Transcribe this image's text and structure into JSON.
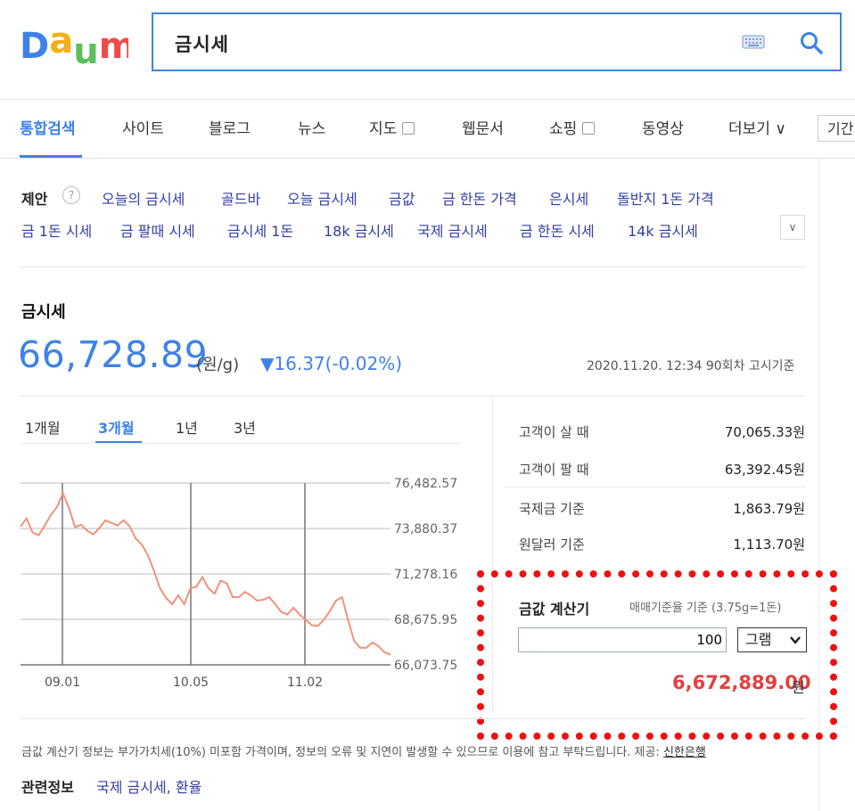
{
  "header": {
    "logo_text": "Daum",
    "search_value": "금시세"
  },
  "tabs": [
    {
      "label": "통합검색",
      "active": true
    },
    {
      "label": "사이트"
    },
    {
      "label": "블로그"
    },
    {
      "label": "뉴스"
    },
    {
      "label": "지도",
      "box": true
    },
    {
      "label": "웹문서"
    },
    {
      "label": "쇼핑",
      "box": true
    },
    {
      "label": "동영상"
    },
    {
      "label": "더보기 ∨"
    }
  ],
  "period_filter": "기간",
  "suggestions": {
    "label": "제안",
    "help": "?",
    "row1": [
      "오늘의 금시세",
      "골드바",
      "오늘 금시세",
      "금값",
      "금 한돈 가격",
      "은시세",
      "돌반지 1돈 가격"
    ],
    "row2": [
      "금 1돈 시세",
      "금 팔때 시세",
      "금시세 1돈",
      "18k 금시세",
      "국제 금시세",
      "금 한돈 시세",
      "14k 금시세"
    ],
    "more": "∨"
  },
  "gold": {
    "title": "금시세",
    "price": "66,728.89",
    "unit": "(원/g)",
    "change": "▼16.37(-0.02%)",
    "notice": "2020.11.20. 12:34 90회차 고시기준"
  },
  "period_tabs": [
    {
      "label": "1개월"
    },
    {
      "label": "3개월",
      "active": true
    },
    {
      "label": "1년"
    },
    {
      "label": "3년"
    }
  ],
  "chart_data": {
    "type": "line",
    "title": "",
    "xlabel": "",
    "ylabel": "",
    "x_ticks": [
      "09.01",
      "10.05",
      "11.02"
    ],
    "y_ticks": [
      "76,482.57",
      "73,880.37",
      "71,278.16",
      "68,675.95",
      "66,073.75"
    ],
    "ylim": [
      66073.75,
      76482.57
    ],
    "grid": true,
    "color": "#f0927a",
    "series": [
      {
        "values": [
          74000,
          74450,
          73650,
          73500,
          74050,
          74650,
          75100,
          75900,
          75050,
          73950,
          74100,
          73750,
          73550,
          73900,
          74350,
          74200,
          74050,
          74350,
          74000,
          73300,
          72950,
          72350,
          71450,
          70450,
          69900,
          69550,
          70050,
          69550,
          70450,
          70550,
          71100,
          70450,
          70150,
          70900,
          70750,
          69950,
          69950,
          70250,
          70050,
          69750,
          69800,
          69950,
          69550,
          69100,
          68950,
          69350,
          68950,
          68650,
          68350,
          68300,
          68650,
          69150,
          69750,
          69950,
          68650,
          67450,
          67050,
          67050,
          67350,
          67150,
          66800,
          66650
        ]
      }
    ]
  },
  "side_table": [
    {
      "label": "고객이 살 때",
      "value": "70,065.33원"
    },
    {
      "label": "고객이 팔 때",
      "value": "63,392.45원"
    },
    {
      "label": "국제금 기준",
      "value": "1,863.79원"
    },
    {
      "label": "원달러 기준",
      "value": "1,113.70원"
    }
  ],
  "calculator": {
    "title": "금값 계산기",
    "basis": "매매기준율 기준 (3.75g=1돈)",
    "input_value": "100",
    "unit_select": "그램",
    "result": "6,672,889.00",
    "result_unit": "원"
  },
  "disclaimer_text": "금값 계산기 정보는 부가가치세(10%) 미포함 가격이며, 정보의 오류 및 지연이 발생할 수 있으므로 이용에 참고 부탁드립니다. 제공: ",
  "provider": "신한은행",
  "related": {
    "label": "관련정보",
    "links": "국제 금시세, 환율"
  },
  "colors": {
    "accent": "#3e82e7",
    "link": "#3340a5",
    "negative": "#e34040",
    "highlight_frame": "#e11"
  }
}
